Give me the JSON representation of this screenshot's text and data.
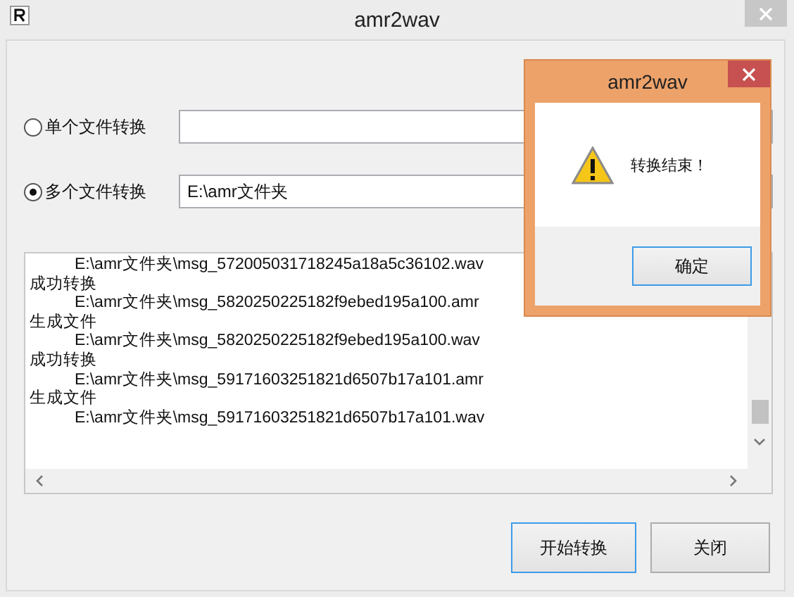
{
  "window": {
    "title": "amr2wav"
  },
  "options": [
    {
      "label": "单个文件转换",
      "selected": false
    },
    {
      "label": "多个文件转换",
      "selected": true,
      "value": "E:\\amr文件夹"
    }
  ],
  "log": {
    "lines": [
      {
        "kind": "path",
        "text": "E:\\amr文件夹\\msg_572005031718245a18a5c36102.wav"
      },
      {
        "kind": "status",
        "text": "成功转换"
      },
      {
        "kind": "path",
        "text": "E:\\amr文件夹\\msg_5820250225182f9ebed195a100.amr"
      },
      {
        "kind": "status",
        "text": "生成文件"
      },
      {
        "kind": "path",
        "text": "E:\\amr文件夹\\msg_5820250225182f9ebed195a100.wav"
      },
      {
        "kind": "status",
        "text": "成功转换"
      },
      {
        "kind": "path",
        "text": "E:\\amr文件夹\\msg_59171603251821d6507b17a101.amr"
      },
      {
        "kind": "status",
        "text": "生成文件"
      },
      {
        "kind": "path",
        "text": "E:\\amr文件夹\\msg_59171603251821d6507b17a101.wav"
      }
    ]
  },
  "buttons": [
    {
      "label": "开始转换",
      "focused": true
    },
    {
      "label": "关闭",
      "focused": false
    }
  ],
  "dialog": {
    "title": "amr2wav",
    "message": "转换结束！",
    "button": "确定"
  }
}
